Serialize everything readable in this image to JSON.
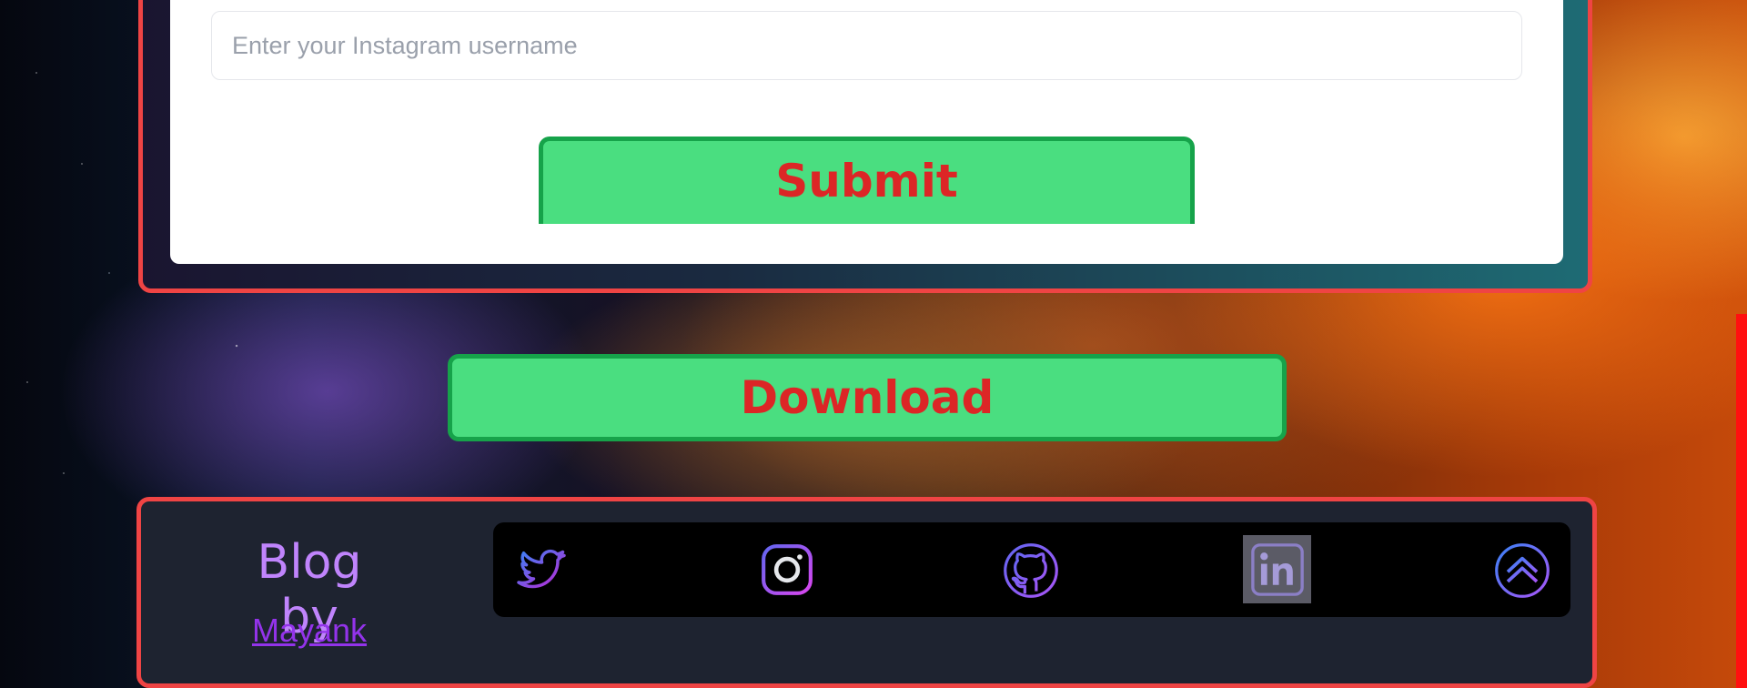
{
  "form": {
    "username_placeholder": "Enter your Instagram username",
    "submit_label": "Submit"
  },
  "actions": {
    "download_label": "Download"
  },
  "footer": {
    "blog_by": "Blog by",
    "author": "Mayank",
    "social_icons": [
      "twitter-icon",
      "instagram-icon",
      "github-icon",
      "linkedin-icon",
      "chevron-up-icon"
    ]
  },
  "colors": {
    "accent_red": "#ef4444",
    "button_green": "#4ade80",
    "button_text": "#dc2626",
    "purple": "#c084fc",
    "footer_bg": "#1e2330"
  }
}
